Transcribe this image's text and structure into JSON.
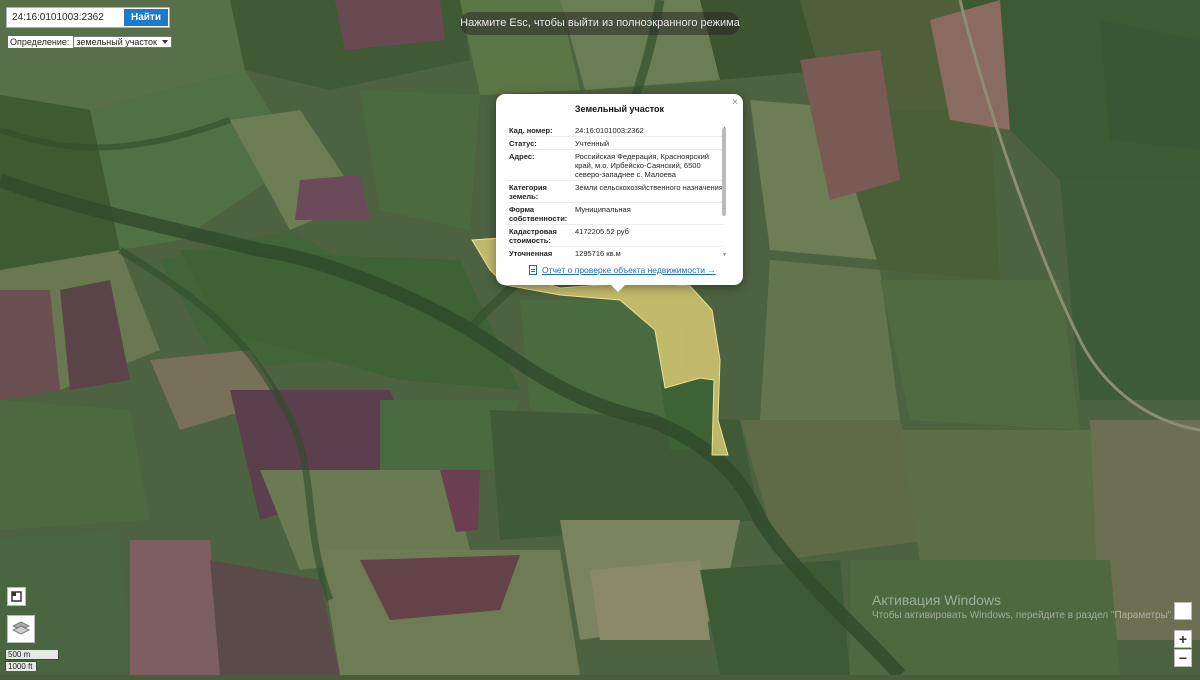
{
  "search": {
    "value": "24:16:0101003:2362",
    "button_label": "Найти"
  },
  "definition": {
    "label": "Определение:",
    "selected": "земельный участок"
  },
  "fullscreen_hint": "Нажмите Esc, чтобы выйти из полноэкранного режима",
  "popup": {
    "title": "Земельный участок",
    "close_symbol": "×",
    "rows": [
      {
        "key": "Кад. номер:",
        "value": "24:16:0101003:2362"
      },
      {
        "key": "Статус:",
        "value": "Учтенный"
      },
      {
        "key": "Адрес:",
        "value": "Российская Федерация, Красноярский край, м.о. Ирбейско-Саянский, 6500 северо-западнее с. Малоева"
      },
      {
        "key": "Категория земель:",
        "value": "Земли сельскохозяйственного назначения"
      },
      {
        "key": "Форма собственности:",
        "value": "Муниципальная"
      },
      {
        "key": "Кадастровая стоимость:",
        "value": "4172205.52 руб"
      },
      {
        "key": "Уточненная площадь:",
        "value": "1295716 кв.м"
      }
    ],
    "report_link": "Отчет о проверке объекта недвижимости →"
  },
  "map_controls": {
    "zoom_in": "+",
    "zoom_out": "−"
  },
  "scale": {
    "metric": "500 m",
    "imperial": "1000 ft"
  },
  "watermark": {
    "title": "Активация Windows",
    "subtitle": "Чтобы активировать Windows, перейдите в раздел \"Параметры\"."
  },
  "colors": {
    "parcel_fill": "#e8d67a",
    "accent": "#1d79c9",
    "link": "#1a6fc0"
  },
  "icons": [
    "document-icon",
    "layers-icon",
    "fullscreen-icon",
    "close-icon"
  ]
}
